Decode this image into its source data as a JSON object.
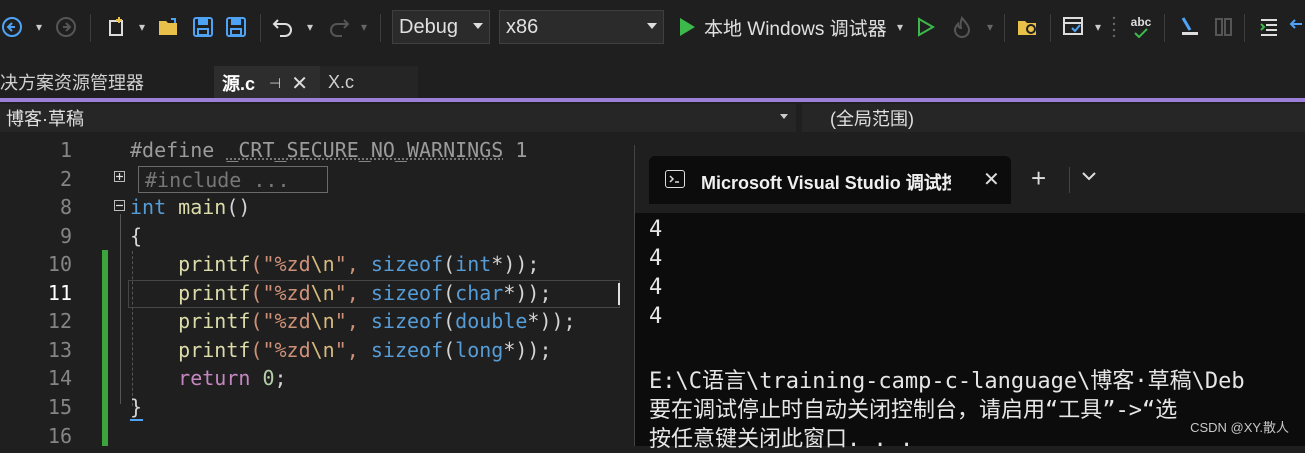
{
  "toolbar": {
    "config": "Debug",
    "platform": "x86",
    "run_label": "本地 Windows 调试器"
  },
  "tabs": {
    "solution_explorer": "决方案资源管理器",
    "active_file": "源.c",
    "other_file": "X.c"
  },
  "navbar": {
    "project": "博客·草稿",
    "scope": "(全局范围)"
  },
  "editor": {
    "line_numbers": [
      "1",
      "2",
      "8",
      "9",
      "10",
      "11",
      "12",
      "13",
      "14",
      "15",
      "16"
    ],
    "line1_define": "#define ",
    "line1_macro": "_CRT_SECURE_NO_WARNINGS",
    "line1_val": " 1",
    "line2_collapsed": "#include ...",
    "kw_int": "int",
    "fn_main": "main",
    "parens": "()",
    "brace_open": "{",
    "brace_close": "}",
    "printf": "printf",
    "fmt_pre": "(\"%zd",
    "fmt_esc": "\\n",
    "fmt_post": "\", ",
    "sizeof": "sizeof",
    "types": [
      "int",
      "char",
      "double",
      "long"
    ],
    "ptr_close": "*));",
    "return_kw": "return",
    "return_val": "0",
    "semicolon": ";"
  },
  "terminal": {
    "tab_title": "Microsoft Visual Studio 调试控",
    "output_lines": [
      "4",
      "4",
      "4",
      "4"
    ],
    "path_line": "E:\\C语言\\training-camp-c-language\\博客·草稿\\Deb",
    "hint_line": "要在调试停止时自动关闭控制台，请启用“工具”->“选",
    "close_line": "按任意键关闭此窗口. . ."
  },
  "watermark": "CSDN @XY.散人"
}
